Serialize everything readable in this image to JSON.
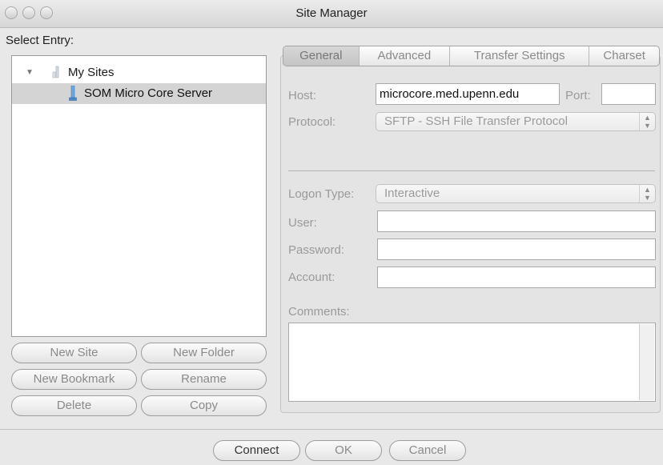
{
  "window": {
    "title": "Site Manager"
  },
  "left": {
    "select_label": "Select Entry:",
    "tree": [
      {
        "label": "My Sites",
        "type": "folder",
        "expanded": true
      },
      {
        "label": "SOM Micro Core Server",
        "type": "site",
        "selected": true
      }
    ],
    "buttons": {
      "new_site": "New Site",
      "new_folder": "New Folder",
      "new_bookmark": "New Bookmark",
      "rename": "Rename",
      "delete": "Delete",
      "copy": "Copy"
    }
  },
  "tabs": [
    "General",
    "Advanced",
    "Transfer Settings",
    "Charset"
  ],
  "selected_tab": "General",
  "general": {
    "host_label": "Host:",
    "host_value": "microcore.med.upenn.edu",
    "port_label": "Port:",
    "port_value": "",
    "protocol_label": "Protocol:",
    "protocol_value": "SFTP - SSH File Transfer Protocol",
    "logon_label": "Logon Type:",
    "logon_value": "Interactive",
    "user_label": "User:",
    "user_value": "",
    "password_label": "Password:",
    "password_value": "",
    "account_label": "Account:",
    "account_value": "",
    "comments_label": "Comments:"
  },
  "footer": {
    "connect": "Connect",
    "ok": "OK",
    "cancel": "Cancel"
  },
  "icons": {
    "folder": "folder-icon",
    "site": "server-icon",
    "disclosure": "disclosure-triangle-icon"
  }
}
